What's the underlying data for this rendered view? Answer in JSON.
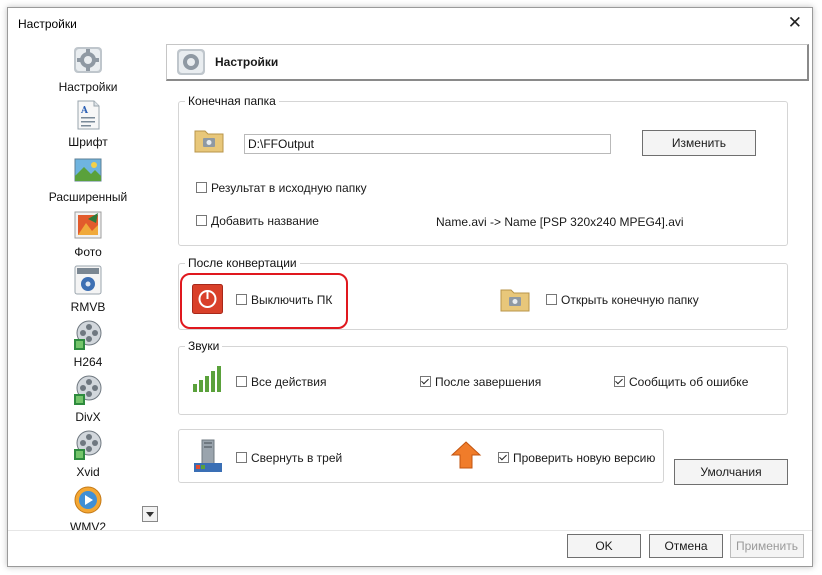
{
  "window": {
    "title": "Настройки",
    "close_glyph": "✕"
  },
  "sidebar": {
    "items": [
      {
        "label": "Настройки",
        "icon": "settings-gear-icon"
      },
      {
        "label": "Шрифт",
        "icon": "font-document-icon"
      },
      {
        "label": "Расширенный",
        "icon": "landscape-image-icon"
      },
      {
        "label": "Фото",
        "icon": "photo-icon"
      },
      {
        "label": "RMVB",
        "icon": "real-media-icon"
      },
      {
        "label": "H264",
        "icon": "film-reel-icon"
      },
      {
        "label": "DivX",
        "icon": "film-reel-icon"
      },
      {
        "label": "Xvid",
        "icon": "film-reel-icon"
      },
      {
        "label": "WMV2",
        "icon": "media-player-icon"
      }
    ]
  },
  "header": {
    "title": "Настройки"
  },
  "output_folder": {
    "legend": "Конечная папка",
    "path_value": "D:\\FFOutput",
    "change_button": "Изменить",
    "result_in_source": {
      "label": "Результат в исходную папку",
      "checked": false
    },
    "add_name": {
      "label": "Добавить название",
      "checked": false
    },
    "name_example": "Name.avi  -> Name [PSP 320x240 MPEG4].avi"
  },
  "after_conversion": {
    "legend": "После конвертации",
    "shutdown": {
      "label": "Выключить ПК",
      "checked": false
    },
    "open_folder": {
      "label": "Открыть конечную папку",
      "checked": false
    }
  },
  "sounds": {
    "legend": "Звуки",
    "all_actions": {
      "label": "Все действия",
      "checked": false
    },
    "after_finish": {
      "label": "После завершения",
      "checked": true
    },
    "report_error": {
      "label": "Сообщить об ошибке",
      "checked": true
    }
  },
  "misc": {
    "minimize_tray": {
      "label": "Свернуть в трей",
      "checked": false
    },
    "check_update": {
      "label": "Проверить новую версию",
      "checked": true
    }
  },
  "buttons": {
    "defaults": "Умолчания",
    "ok": "OK",
    "cancel": "Отмена",
    "apply": "Применить"
  },
  "colors": {
    "highlight": "#e0181e",
    "power_icon": "#d9402a"
  }
}
